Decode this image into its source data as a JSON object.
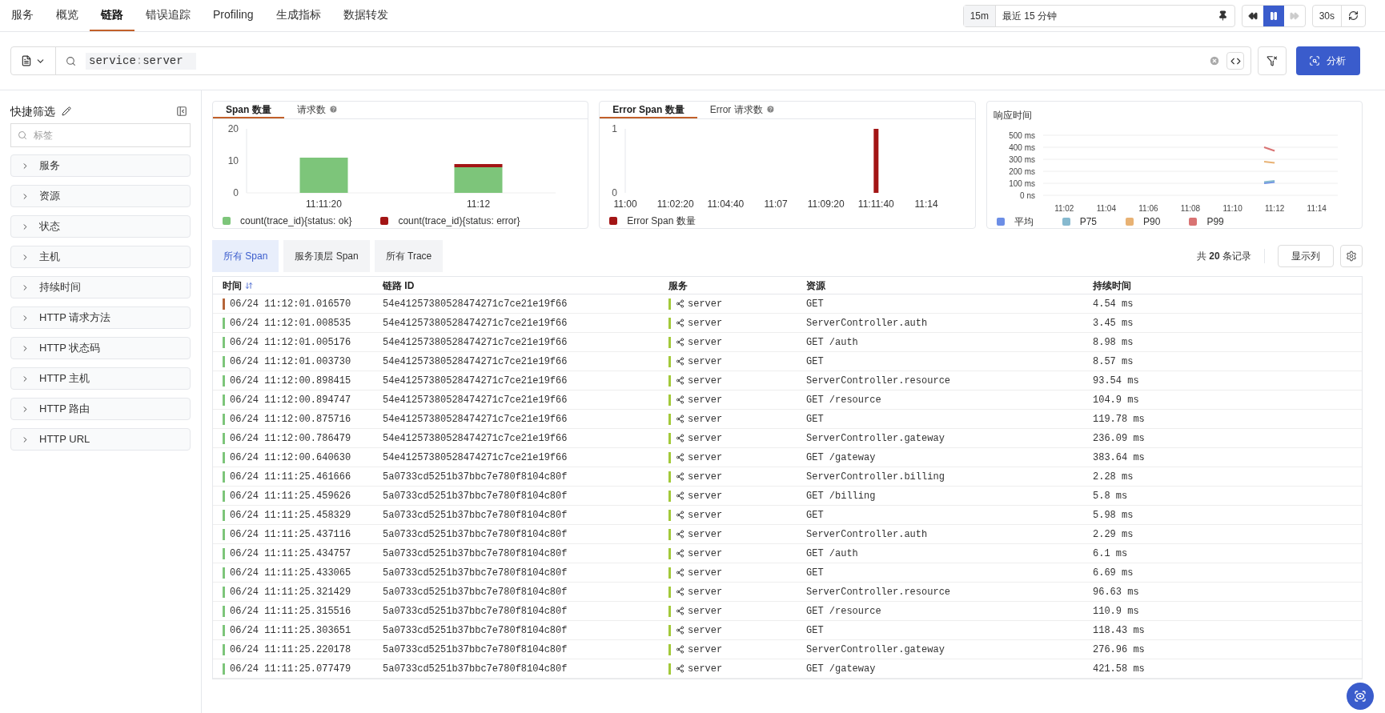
{
  "nav": {
    "tabs": [
      {
        "label": "服务",
        "selected": false
      },
      {
        "label": "概览",
        "selected": false
      },
      {
        "label": "链路",
        "selected": true
      },
      {
        "label": "错误追踪",
        "selected": false
      },
      {
        "label": "Profiling",
        "selected": false
      },
      {
        "label": "生成指标",
        "selected": false
      },
      {
        "label": "数据转发",
        "selected": false
      }
    ]
  },
  "time_range": {
    "short": "15m",
    "label": "最近 15 分钟",
    "refresh": "30s",
    "controls": [
      {
        "kind": "rewind",
        "active": false,
        "disabled": false
      },
      {
        "kind": "pause",
        "active": true,
        "disabled": false
      },
      {
        "kind": "forward",
        "active": false,
        "disabled": true
      }
    ]
  },
  "search": {
    "token_key": "service",
    "token_sep": ":",
    "token_value": "server",
    "analyze_button": "分析"
  },
  "sidebar": {
    "title": "快捷筛选",
    "search_placeholder": "标签",
    "items": [
      "服务",
      "资源",
      "状态",
      "主机",
      "持续时间",
      "HTTP 请求方法",
      "HTTP 状态码",
      "HTTP 主机",
      "HTTP 路由",
      "HTTP URL"
    ]
  },
  "charts": [
    {
      "tabs": [
        {
          "label": "Span 数量",
          "selected": true,
          "help": false
        },
        {
          "label": "请求数",
          "selected": false,
          "help": true
        }
      ],
      "kind": "band",
      "chart_data": {
        "type": "bar",
        "stacked": true,
        "categories": [
          "11:11:20",
          "11:12"
        ],
        "series": [
          {
            "name": "count(trace_id){status: ok}",
            "color": "#7dc57a",
            "values": [
              11,
              8
            ]
          },
          {
            "name": "count(trace_id){status: error}",
            "color": "#a31515",
            "values": [
              0,
              1
            ]
          }
        ],
        "ylim": [
          0,
          20
        ],
        "yticks": [
          0,
          10,
          20
        ]
      }
    },
    {
      "tabs": [
        {
          "label": "Error Span 数量",
          "selected": true,
          "help": false
        },
        {
          "label": "Error 请求数",
          "selected": false,
          "help": true
        }
      ],
      "kind": "timeline",
      "chart_data": {
        "type": "bar",
        "categories": [
          "11:00",
          "11:02:20",
          "11:04:40",
          "11:07",
          "11:09:20",
          "11:11:40",
          "11:14"
        ],
        "series": [
          {
            "name": "Error Span 数量",
            "color": "#a31515",
            "values": [
              null,
              null,
              null,
              null,
              null,
              1,
              null
            ]
          }
        ],
        "ylim": [
          0,
          1
        ],
        "yticks": [
          0,
          1
        ]
      }
    },
    {
      "title": "响应时间",
      "kind": "lines",
      "chart_data": {
        "type": "line",
        "grid": true,
        "categories": [
          null,
          null,
          "11:02",
          null,
          null,
          null,
          "11:04",
          null,
          null,
          null,
          "11:06",
          null,
          null,
          null,
          "11:08",
          null,
          null,
          null,
          "11:10",
          null,
          null,
          null,
          "11:12",
          null,
          null,
          null,
          "11:14",
          null,
          null
        ],
        "series": [
          {
            "name": "平均",
            "color": "#6c8ee6",
            "values": [
              null,
              null,
              null,
              null,
              null,
              null,
              null,
              null,
              null,
              null,
              null,
              null,
              null,
              null,
              null,
              null,
              null,
              null,
              null,
              null,
              null,
              100,
              110,
              null,
              null,
              null,
              null,
              null,
              null
            ]
          },
          {
            "name": "P75",
            "color": "#86b9cf",
            "values": [
              null,
              null,
              null,
              null,
              null,
              null,
              null,
              null,
              null,
              null,
              null,
              null,
              null,
              null,
              null,
              null,
              null,
              null,
              null,
              null,
              null,
              110,
              120,
              null,
              null,
              null,
              null,
              null,
              null
            ]
          },
          {
            "name": "P90",
            "color": "#e8b274",
            "values": [
              null,
              null,
              null,
              null,
              null,
              null,
              null,
              null,
              null,
              null,
              null,
              null,
              null,
              null,
              null,
              null,
              null,
              null,
              null,
              null,
              null,
              280,
              270,
              null,
              null,
              null,
              null,
              null,
              null
            ]
          },
          {
            "name": "P99",
            "color": "#d97373",
            "values": [
              null,
              null,
              null,
              null,
              null,
              null,
              null,
              null,
              null,
              null,
              null,
              null,
              null,
              null,
              null,
              null,
              null,
              null,
              null,
              null,
              null,
              400,
              370,
              null,
              null,
              null,
              null,
              null,
              null
            ]
          }
        ],
        "ylim": [
          0,
          500
        ],
        "yticks": [
          {
            "value": 0,
            "label": "0 ns"
          },
          {
            "value": 100,
            "label": "100 ms"
          },
          {
            "value": 200,
            "label": "200 ms"
          },
          {
            "value": 300,
            "label": "300 ms"
          },
          {
            "value": 400,
            "label": "400 ms"
          },
          {
            "value": 500,
            "label": "500 ms"
          }
        ]
      }
    }
  ],
  "table_tabs": [
    {
      "label": "所有 Span",
      "selected": true
    },
    {
      "label": "服务顶层 Span",
      "selected": false
    },
    {
      "label": "所有 Trace",
      "selected": false
    }
  ],
  "record_count": "共 **20** 条记录",
  "columns_button": "显示列",
  "table": {
    "columns": [
      {
        "label": "时间",
        "sorted": true
      },
      {
        "label": "链路 ID",
        "sorted": false
      },
      {
        "label": "服务",
        "sorted": false
      },
      {
        "label": "资源",
        "sorted": false
      },
      {
        "label": "持续时间",
        "sorted": false
      }
    ],
    "rows": [
      {
        "color": "#b5653a",
        "time": "06/24 11:12:01.016570",
        "trace_id": "54e41257380528474271c7ce21e19f66",
        "service": "server",
        "resource": "GET",
        "duration": "4.54 ms"
      },
      {
        "color": "#7dc57a",
        "time": "06/24 11:12:01.008535",
        "trace_id": "54e41257380528474271c7ce21e19f66",
        "service": "server",
        "resource": "ServerController.auth",
        "duration": "3.45 ms"
      },
      {
        "color": "#7dc57a",
        "time": "06/24 11:12:01.005176",
        "trace_id": "54e41257380528474271c7ce21e19f66",
        "service": "server",
        "resource": "GET /auth",
        "duration": "8.98 ms"
      },
      {
        "color": "#7dc57a",
        "time": "06/24 11:12:01.003730",
        "trace_id": "54e41257380528474271c7ce21e19f66",
        "service": "server",
        "resource": "GET",
        "duration": "8.57 ms"
      },
      {
        "color": "#7dc57a",
        "time": "06/24 11:12:00.898415",
        "trace_id": "54e41257380528474271c7ce21e19f66",
        "service": "server",
        "resource": "ServerController.resource",
        "duration": "93.54 ms"
      },
      {
        "color": "#7dc57a",
        "time": "06/24 11:12:00.894747",
        "trace_id": "54e41257380528474271c7ce21e19f66",
        "service": "server",
        "resource": "GET /resource",
        "duration": "104.9 ms"
      },
      {
        "color": "#7dc57a",
        "time": "06/24 11:12:00.875716",
        "trace_id": "54e41257380528474271c7ce21e19f66",
        "service": "server",
        "resource": "GET",
        "duration": "119.78 ms"
      },
      {
        "color": "#7dc57a",
        "time": "06/24 11:12:00.786479",
        "trace_id": "54e41257380528474271c7ce21e19f66",
        "service": "server",
        "resource": "ServerController.gateway",
        "duration": "236.09 ms"
      },
      {
        "color": "#7dc57a",
        "time": "06/24 11:12:00.640630",
        "trace_id": "54e41257380528474271c7ce21e19f66",
        "service": "server",
        "resource": "GET /gateway",
        "duration": "383.64 ms"
      },
      {
        "color": "#7dc57a",
        "time": "06/24 11:11:25.461666",
        "trace_id": "5a0733cd5251b37bbc7e780f8104c80f",
        "service": "server",
        "resource": "ServerController.billing",
        "duration": "2.28 ms"
      },
      {
        "color": "#7dc57a",
        "time": "06/24 11:11:25.459626",
        "trace_id": "5a0733cd5251b37bbc7e780f8104c80f",
        "service": "server",
        "resource": "GET /billing",
        "duration": "5.8 ms"
      },
      {
        "color": "#7dc57a",
        "time": "06/24 11:11:25.458329",
        "trace_id": "5a0733cd5251b37bbc7e780f8104c80f",
        "service": "server",
        "resource": "GET",
        "duration": "5.98 ms"
      },
      {
        "color": "#7dc57a",
        "time": "06/24 11:11:25.437116",
        "trace_id": "5a0733cd5251b37bbc7e780f8104c80f",
        "service": "server",
        "resource": "ServerController.auth",
        "duration": "2.29 ms"
      },
      {
        "color": "#7dc57a",
        "time": "06/24 11:11:25.434757",
        "trace_id": "5a0733cd5251b37bbc7e780f8104c80f",
        "service": "server",
        "resource": "GET /auth",
        "duration": "6.1 ms"
      },
      {
        "color": "#7dc57a",
        "time": "06/24 11:11:25.433065",
        "trace_id": "5a0733cd5251b37bbc7e780f8104c80f",
        "service": "server",
        "resource": "GET",
        "duration": "6.69 ms"
      },
      {
        "color": "#7dc57a",
        "time": "06/24 11:11:25.321429",
        "trace_id": "5a0733cd5251b37bbc7e780f8104c80f",
        "service": "server",
        "resource": "ServerController.resource",
        "duration": "96.63 ms"
      },
      {
        "color": "#7dc57a",
        "time": "06/24 11:11:25.315516",
        "trace_id": "5a0733cd5251b37bbc7e780f8104c80f",
        "service": "server",
        "resource": "GET /resource",
        "duration": "110.9 ms"
      },
      {
        "color": "#7dc57a",
        "time": "06/24 11:11:25.303651",
        "trace_id": "5a0733cd5251b37bbc7e780f8104c80f",
        "service": "server",
        "resource": "GET",
        "duration": "118.43 ms"
      },
      {
        "color": "#7dc57a",
        "time": "06/24 11:11:25.220178",
        "trace_id": "5a0733cd5251b37bbc7e780f8104c80f",
        "service": "server",
        "resource": "ServerController.gateway",
        "duration": "276.96 ms"
      },
      {
        "color": "#7dc57a",
        "time": "06/24 11:11:25.077479",
        "trace_id": "5a0733cd5251b37bbc7e780f8104c80f",
        "service": "server",
        "resource": "GET /gateway",
        "duration": "421.58 ms"
      }
    ]
  }
}
